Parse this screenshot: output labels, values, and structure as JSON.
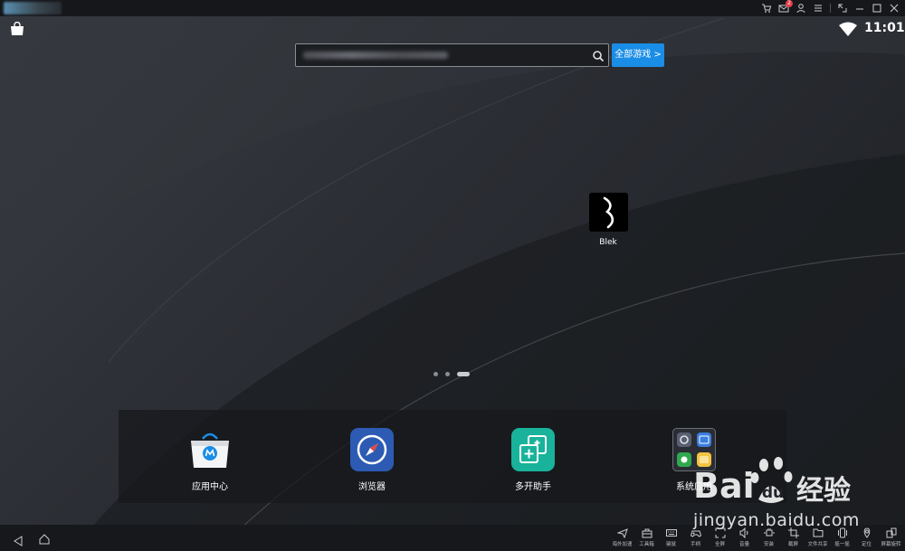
{
  "titlebar": {
    "icons": [
      "cart-icon",
      "mail-icon",
      "user-icon",
      "menu-icon",
      "resize-icon",
      "minimize-icon",
      "maximize-icon",
      "close-icon"
    ],
    "mail_badge": "2"
  },
  "statusbar": {
    "time": "11:01"
  },
  "search": {
    "placeholder": "",
    "all_games_label": "全部游戏 >"
  },
  "desktop": {
    "apps": [
      {
        "label": "Blek"
      }
    ]
  },
  "pager": {
    "count": 3,
    "active_index": 2
  },
  "dock": {
    "apps": [
      {
        "label": "应用中心",
        "icon": "app-center-icon"
      },
      {
        "label": "浏览器",
        "icon": "browser-icon"
      },
      {
        "label": "多开助手",
        "icon": "multi-instance-icon"
      },
      {
        "label": "系统应用",
        "icon": "system-apps-icon"
      }
    ]
  },
  "toolbar": {
    "items": [
      {
        "label": "海外加速",
        "icon": "plane-icon"
      },
      {
        "label": "工具箱",
        "icon": "toolbox-icon"
      },
      {
        "label": "键鼠",
        "icon": "keyboard-icon"
      },
      {
        "label": "手柄",
        "icon": "gamepad-icon"
      },
      {
        "label": "全屏",
        "icon": "fullscreen-icon"
      },
      {
        "label": "音量",
        "icon": "volume-icon"
      },
      {
        "label": "安装",
        "icon": "install-icon"
      },
      {
        "label": "截屏",
        "icon": "crop-icon"
      },
      {
        "label": "文件共享",
        "icon": "folder-icon"
      },
      {
        "label": "摇一摇",
        "icon": "shake-icon"
      },
      {
        "label": "定位",
        "icon": "location-icon"
      },
      {
        "label": "屏幕旋转",
        "icon": "rotate-icon"
      }
    ]
  },
  "watermark": {
    "text": "Baidu经验",
    "url": "jingyan.baidu.com"
  },
  "colors": {
    "accent": "#1a8de6",
    "background": "#202227"
  }
}
